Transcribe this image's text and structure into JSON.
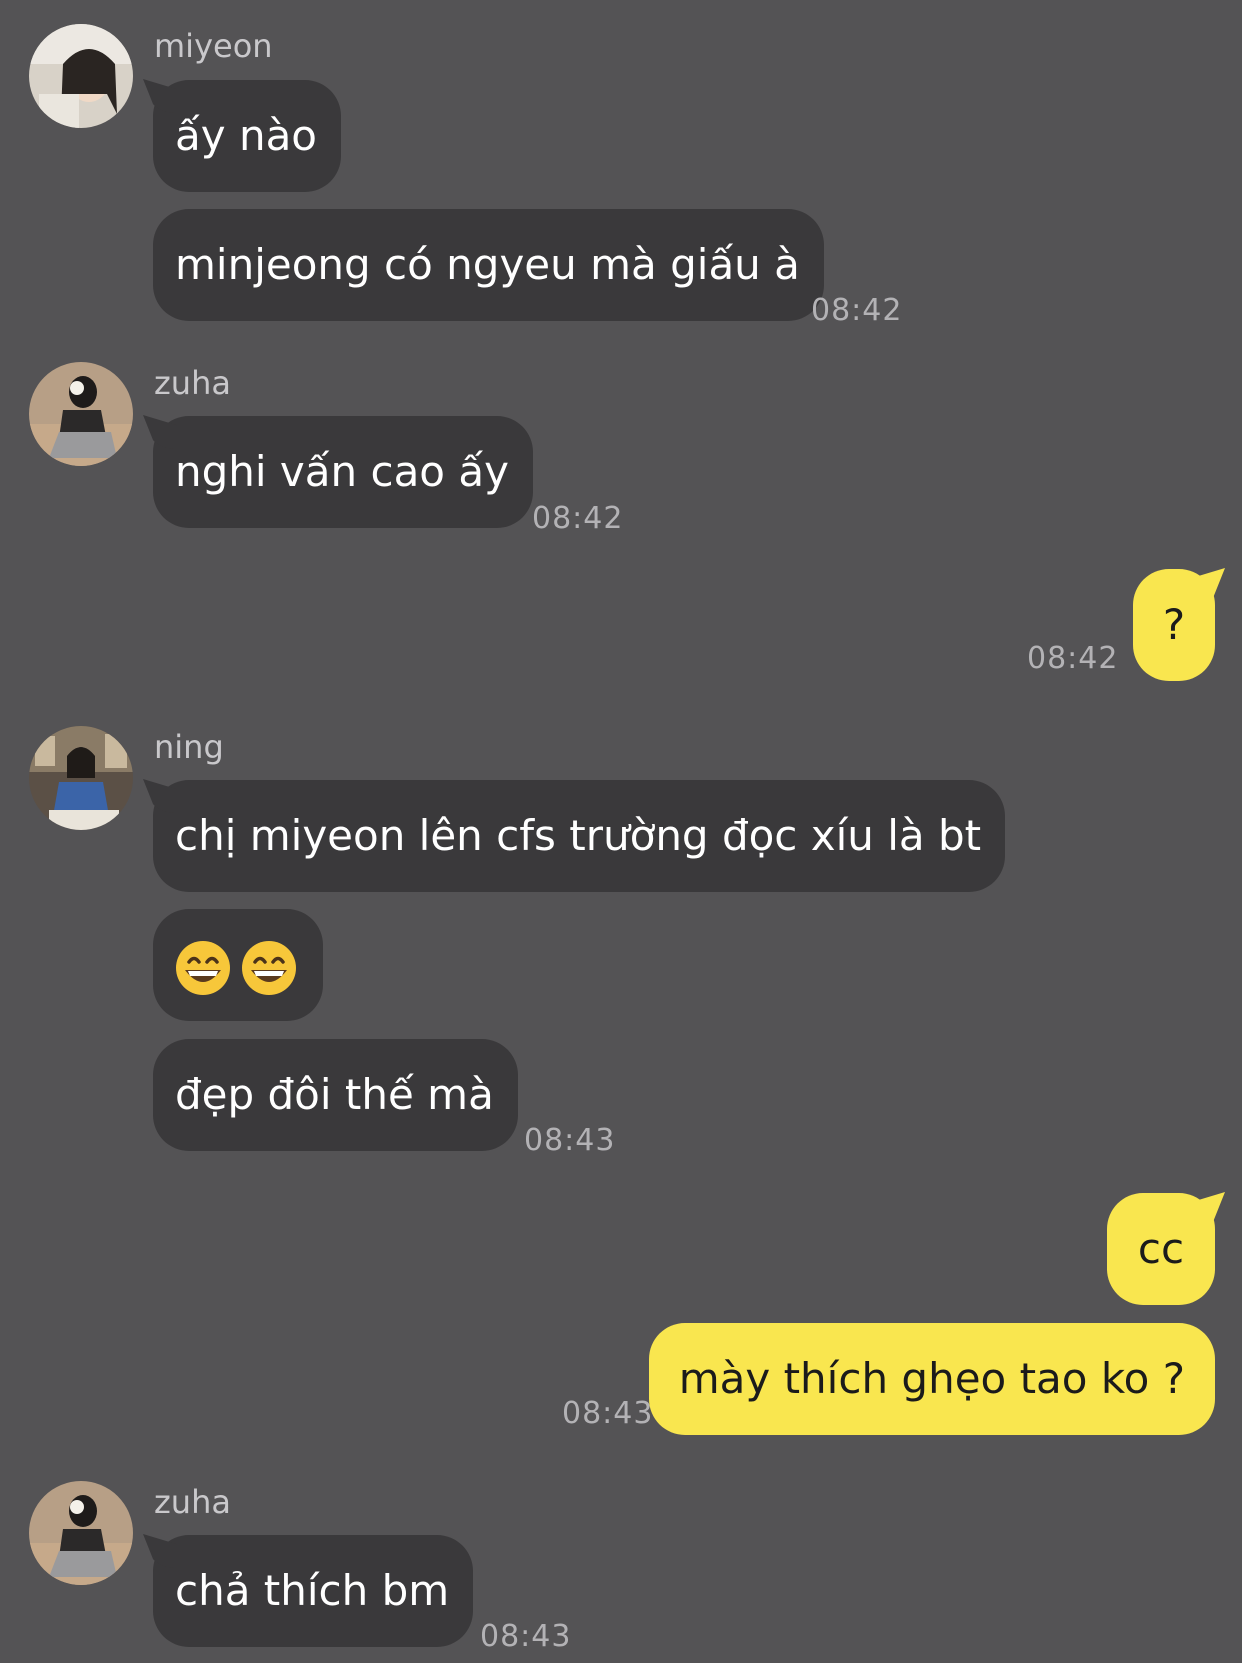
{
  "messages": {
    "m1": {
      "sender": "miyeon",
      "b1": "ấy nào",
      "b2": "minjeong có ngyeu mà giấu à",
      "time": "08:42"
    },
    "m2": {
      "sender": "zuha",
      "b1": "nghi vấn cao ấy",
      "time": "08:42"
    },
    "m3": {
      "b1": "?",
      "time": "08:42"
    },
    "m4": {
      "sender": "ning",
      "b1": "chị miyeon lên cfs trường đọc xíu là bt",
      "b2": "😄😄",
      "b3": "đẹp đôi thế mà",
      "time": "08:43"
    },
    "m5": {
      "b1": "cc",
      "b2": "mày thích ghẹo tao ko ?",
      "time": "08:43"
    },
    "m6": {
      "sender": "zuha",
      "b1": "chả thích bm",
      "time": "08:43"
    }
  },
  "colors": {
    "background": "#545355",
    "incoming_bubble": "#3a393b",
    "outgoing_bubble": "#f9e64f"
  }
}
